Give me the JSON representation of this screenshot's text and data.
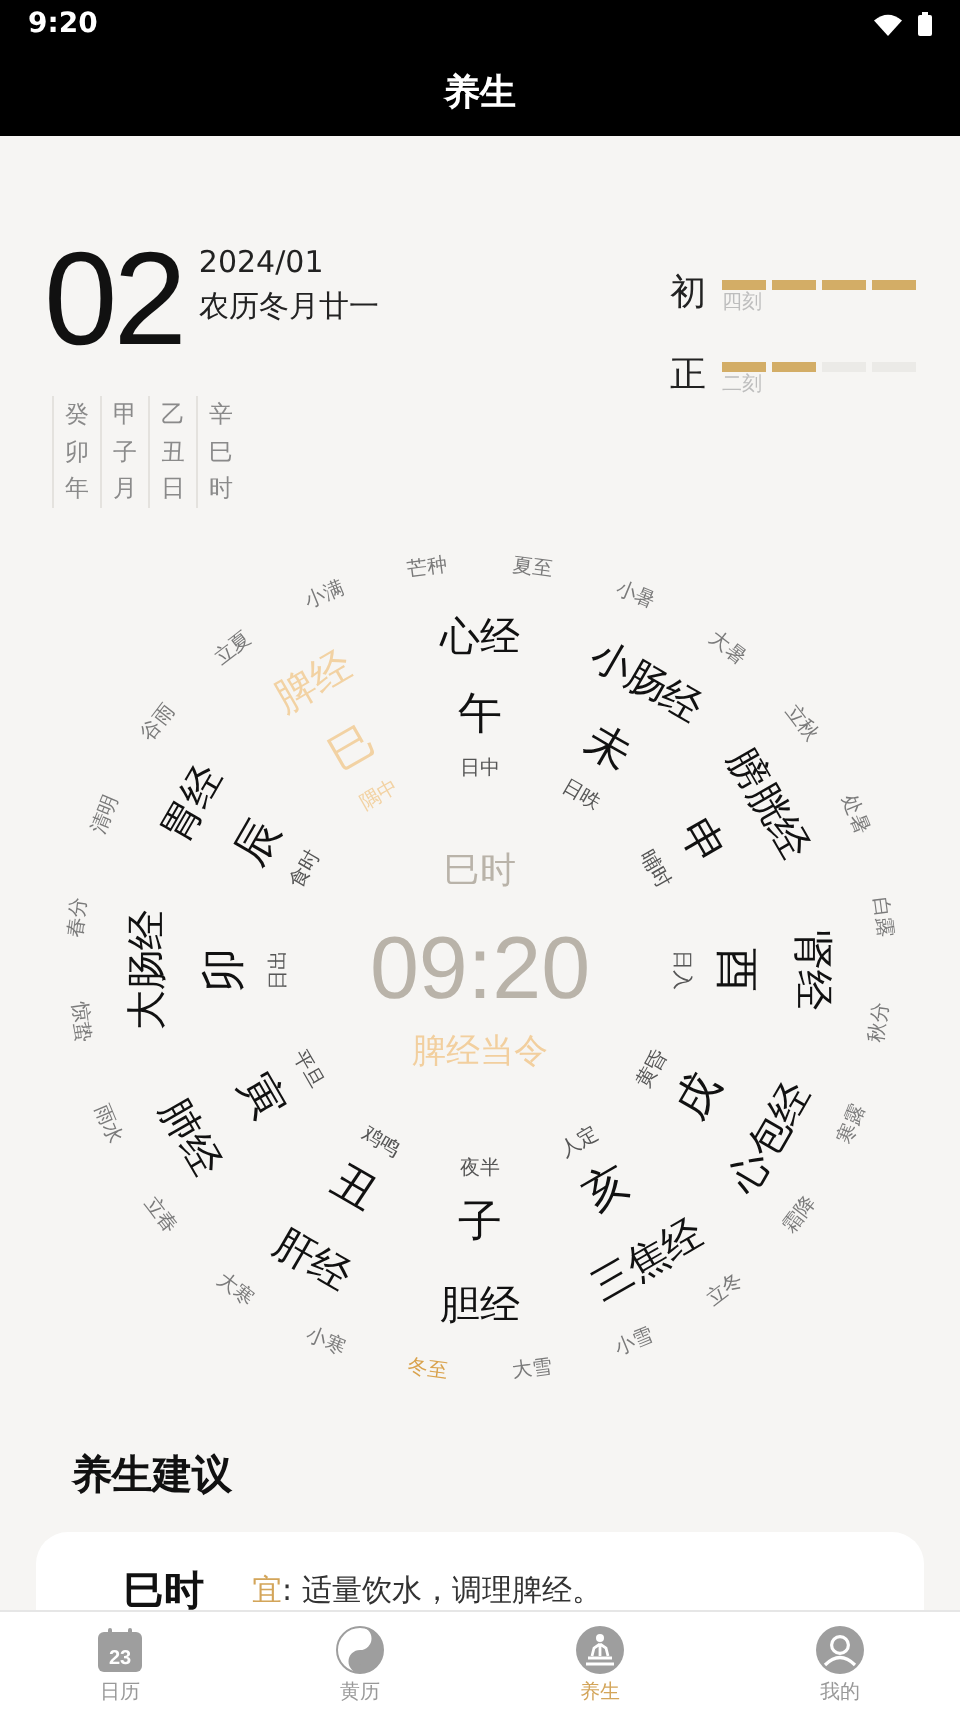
{
  "status_bar": {
    "time": "9:20"
  },
  "header": {
    "title": "养生"
  },
  "date": {
    "day": "02",
    "year_month": "2024/01",
    "lunar": "农历冬月廿一"
  },
  "ganzhi": [
    {
      "text": "癸卯年"
    },
    {
      "text": "甲子月"
    },
    {
      "text": "乙丑日"
    },
    {
      "text": "辛巳时"
    }
  ],
  "quarters": [
    {
      "label": "初",
      "caption": "四刻",
      "level": 1
    },
    {
      "label": "正",
      "caption": "二刻",
      "level": 0.5
    }
  ],
  "wheel": {
    "branches": [
      {
        "branch": "午",
        "time_name": "日中",
        "meridian": "心经",
        "selected": false
      },
      {
        "branch": "未",
        "time_name": "日昳",
        "meridian": "小肠经",
        "selected": false
      },
      {
        "branch": "申",
        "time_name": "晡时",
        "meridian": "膀胱经",
        "selected": false
      },
      {
        "branch": "酉",
        "time_name": "日入",
        "meridian": "肾经",
        "selected": false
      },
      {
        "branch": "戌",
        "time_name": "黄昏",
        "meridian": "心包经",
        "selected": false
      },
      {
        "branch": "亥",
        "time_name": "人定",
        "meridian": "三焦经",
        "selected": false
      },
      {
        "branch": "子",
        "time_name": "夜半",
        "meridian": "胆经",
        "selected": false
      },
      {
        "branch": "丑",
        "time_name": "鸡鸣",
        "meridian": "肝经",
        "selected": false
      },
      {
        "branch": "寅",
        "time_name": "平旦",
        "meridian": "肺经",
        "selected": false
      },
      {
        "branch": "卯",
        "time_name": "日出",
        "meridian": "大肠经",
        "selected": false
      },
      {
        "branch": "辰",
        "time_name": "食时",
        "meridian": "胃经",
        "selected": false
      },
      {
        "branch": "巳",
        "time_name": "隅中",
        "meridian": "脾经",
        "selected": true
      }
    ],
    "solar_terms": [
      {
        "label": "芒种",
        "selected": false
      },
      {
        "label": "夏至",
        "selected": false
      },
      {
        "label": "小暑",
        "selected": false
      },
      {
        "label": "大暑",
        "selected": false
      },
      {
        "label": "立秋",
        "selected": false
      },
      {
        "label": "处暑",
        "selected": false
      },
      {
        "label": "白露",
        "selected": false
      },
      {
        "label": "秋分",
        "selected": false
      },
      {
        "label": "寒露",
        "selected": false
      },
      {
        "label": "霜降",
        "selected": false
      },
      {
        "label": "立冬",
        "selected": false
      },
      {
        "label": "小雪",
        "selected": false
      },
      {
        "label": "大雪",
        "selected": false
      },
      {
        "label": "冬至",
        "selected": true
      },
      {
        "label": "小寒",
        "selected": false
      },
      {
        "label": "大寒",
        "selected": false
      },
      {
        "label": "立春",
        "selected": false
      },
      {
        "label": "雨水",
        "selected": false
      },
      {
        "label": "惊蛰",
        "selected": false
      },
      {
        "label": "春分",
        "selected": false
      },
      {
        "label": "清明",
        "selected": false
      },
      {
        "label": "谷雨",
        "selected": false
      },
      {
        "label": "立夏",
        "selected": false
      },
      {
        "label": "小满",
        "selected": false
      }
    ],
    "center": {
      "hour": "巳时",
      "time": "09:20",
      "note": "脾经当令"
    }
  },
  "advice": {
    "title": "养生建议",
    "hour": "巳时",
    "label": "宜",
    "text": ": 适量饮水，调理脾经。"
  },
  "tabs": [
    {
      "label": "日历",
      "icon_text": "23",
      "selected": false
    },
    {
      "label": "黄历",
      "selected": false
    },
    {
      "label": "养生",
      "selected": true
    },
    {
      "label": "我的",
      "selected": false
    }
  ]
}
